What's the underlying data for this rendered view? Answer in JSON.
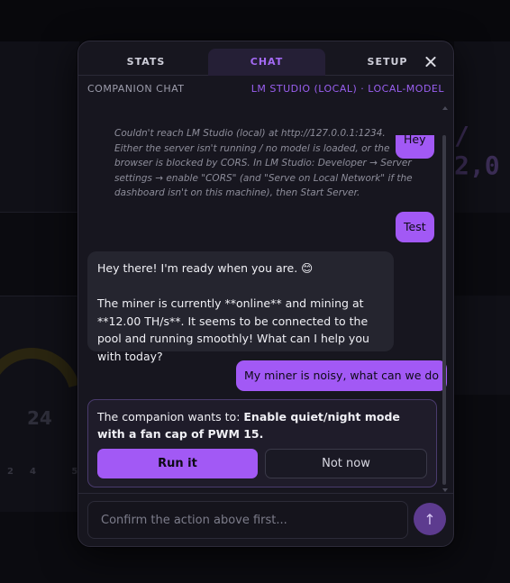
{
  "tabs": [
    {
      "label": "STATS"
    },
    {
      "label": "CHAT"
    },
    {
      "label": "SETUP"
    }
  ],
  "subheader": {
    "title": "COMPANION CHAT",
    "model": "LM STUDIO (LOCAL) · LOCAL-MODEL"
  },
  "messages": {
    "hey": "Hey",
    "error": "Couldn't reach LM Studio (local) at http://127.0.0.1:1234. Either the server isn't running / no model is loaded, or the browser is blocked by CORS. In LM Studio: Developer → Server settings → enable \"CORS\" (and \"Serve on Local Network\" if the dashboard isn't on this machine), then Start Server.",
    "test": "Test",
    "bot_line1": "Hey there! I'm ready when you are. 😊",
    "bot_line2": "The miner is currently **online** and mining at **12.00 TH/s**. It seems to be connected to the pool and running smoothly! What can I help you with today?",
    "user_miner": "My miner is noisy, what can we do"
  },
  "action": {
    "prefix": "The companion wants to: ",
    "description": "Enable quiet/night mode with a fan cap of PWM 15.",
    "run_label": "Run it",
    "decline_label": "Not now"
  },
  "composer": {
    "placeholder": "Confirm the action above first...",
    "send_icon": "↑"
  },
  "background": {
    "hashrate": "/ 2,0",
    "gauge_value": "24",
    "tick_values": "24 58 57"
  },
  "colors": {
    "accent": "#a259f5",
    "tab_active": "#a46af5",
    "modal_bg": "#17161f",
    "bot_bubble": "#25252f"
  }
}
